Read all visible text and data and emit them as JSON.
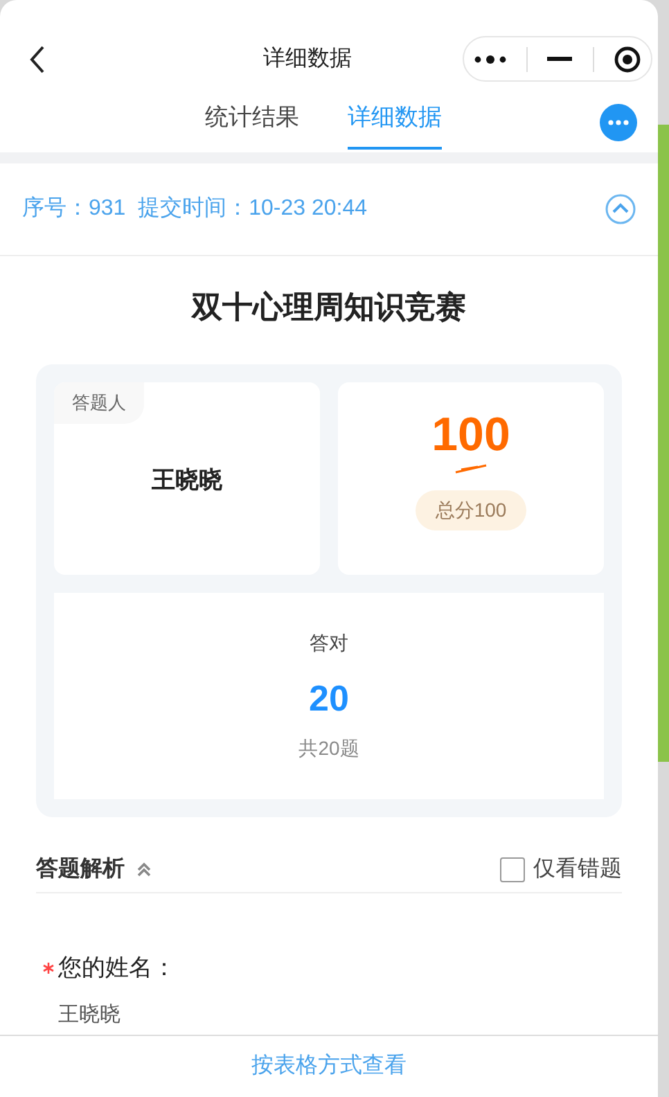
{
  "window": {
    "title": "详细数据"
  },
  "tabs": [
    {
      "label": "统计结果",
      "selected": false
    },
    {
      "label": "详细数据",
      "selected": true
    }
  ],
  "record": {
    "serial_label": "序号：",
    "serial": "931",
    "time_label": "提交时间：",
    "time": "10-23 20:44",
    "expanded": true
  },
  "quiz_title": "双十心理周知识竞赛",
  "respondent": {
    "label": "答题人",
    "name": "王晓晓"
  },
  "score": {
    "value": "100",
    "total": "总分100"
  },
  "correct": {
    "label": "答对",
    "value": "20",
    "total": "共20题"
  },
  "analysis": {
    "title": "答题解析",
    "expanded": true,
    "wrong_only": {
      "label": "仅看错题",
      "checked": false
    }
  },
  "questions": [
    {
      "required": true,
      "question": "您的姓名：",
      "answer": "王晓晓"
    }
  ],
  "footer_link": "按表格方式查看"
}
